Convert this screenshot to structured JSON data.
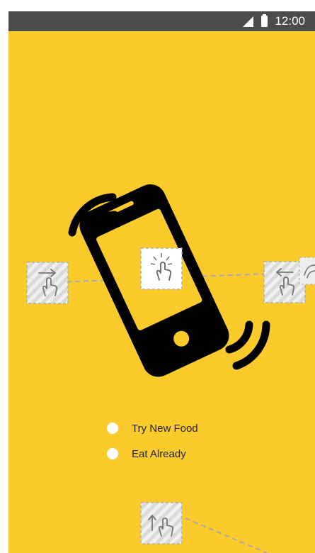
{
  "status_bar": {
    "time": "12:00",
    "icons": [
      "signal-icon",
      "battery-icon"
    ],
    "background": "#4b4b4b"
  },
  "screen": {
    "background": "#FBCB2B",
    "illustration": "vibrating-phone-tap"
  },
  "options": [
    {
      "label": "Try New Food",
      "selected": false
    },
    {
      "label": "Eat Already",
      "selected": false
    }
  ],
  "gesture_hints": [
    "tap-gesture-icon",
    "swipe-right-gesture-icon",
    "swipe-left-gesture-icon",
    "drag-up-gesture-icon"
  ]
}
